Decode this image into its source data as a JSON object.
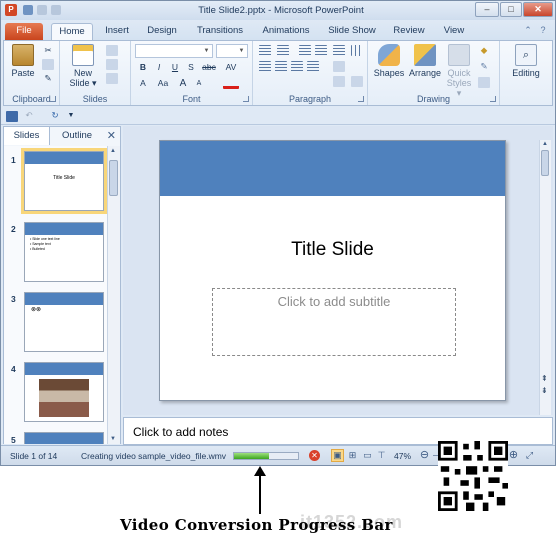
{
  "window": {
    "title": "Title Slide2.pptx - Microsoft PowerPoint",
    "minimize": "–",
    "maximize": "□",
    "close": "✕"
  },
  "tabs": [
    "File",
    "Home",
    "Insert",
    "Design",
    "Transitions",
    "Animations",
    "Slide Show",
    "Review",
    "View"
  ],
  "ribbon": {
    "groups": {
      "clipboard": "Clipboard",
      "slides": "Slides",
      "font": "Font",
      "paragraph": "Paragraph",
      "drawing": "Drawing"
    },
    "buttons": {
      "paste": "Paste",
      "new_slide": "New",
      "new_slide_2": "Slide ▾",
      "shapes": "Shapes",
      "arrange": "Arrange",
      "quick_styles": "Quick",
      "quick_styles_2": "Styles ▾",
      "editing": "Editing"
    },
    "font_buttons": [
      "B",
      "I",
      "U",
      "S",
      "abc",
      "AV"
    ],
    "font_size_buttons": [
      "A",
      "Aa",
      "A",
      "A"
    ]
  },
  "left_pane": {
    "tabs": [
      "Slides",
      "Outline"
    ],
    "close": "✕",
    "thumbnails": [
      {
        "number": "1",
        "text": "Title Slide"
      },
      {
        "number": "2",
        "text": "• Slide one text line\n• Sample text\n• Bulleted"
      },
      {
        "number": "3",
        "text": "⊗⊗"
      },
      {
        "number": "4",
        "text": ""
      },
      {
        "number": "5",
        "text": ""
      }
    ]
  },
  "slide": {
    "title": "Title Slide",
    "subtitle_placeholder": "Click to add subtitle"
  },
  "notes": {
    "placeholder": "Click to add notes"
  },
  "status": {
    "slide_info": "Slide 1 of 14",
    "task_text": "Creating video sample_video_file.wmv",
    "progress": 0.55,
    "zoom": "47%"
  },
  "annotation": {
    "caption": "Video Conversion Progress Bar",
    "watermark": "it1352.com"
  },
  "colors": {
    "slide_band": "#4f81bd",
    "file_tab": "#d24726",
    "progress_fill": "#3ba51e"
  }
}
